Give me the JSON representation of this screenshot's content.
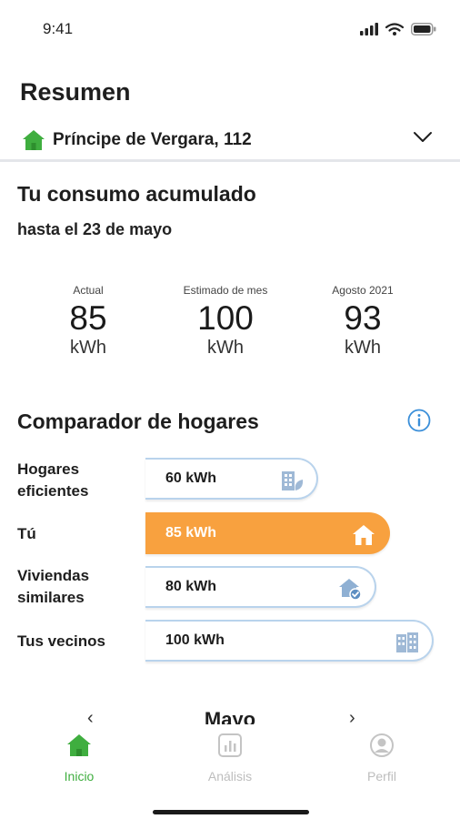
{
  "status_bar": {
    "time": "9:41"
  },
  "header": {
    "title": "Resumen"
  },
  "address": {
    "text": "Príncipe de Vergara, 112"
  },
  "consumption": {
    "title": "Tu consumo acumulado",
    "subtitle": "hasta el 23 de mayo",
    "stats": [
      {
        "label": "Actual",
        "value": "85",
        "unit": "kWh"
      },
      {
        "label": "Estimado de mes",
        "value": "100",
        "unit": "kWh"
      },
      {
        "label": "Agosto 2021",
        "value": "93",
        "unit": "kWh"
      }
    ]
  },
  "comparator": {
    "title": "Comparador de hogares",
    "rows": [
      {
        "label_line1": "Hogares",
        "label_line2": "eficientes",
        "value": "60 kWh",
        "kwh": 60,
        "icon": "efficient-building-icon"
      },
      {
        "label_line1": "Tú",
        "label_line2": "",
        "value": "85 kWh",
        "kwh": 85,
        "icon": "home-icon"
      },
      {
        "label_line1": "Viviendas",
        "label_line2": "similares",
        "value": "80 kWh",
        "kwh": 80,
        "icon": "home-check-icon"
      },
      {
        "label_line1": "Tus vecinos",
        "label_line2": "",
        "value": "100 kWh",
        "kwh": 100,
        "icon": "building-icon"
      }
    ]
  },
  "month_nav": {
    "label": "Mayo",
    "prev": "‹",
    "next": "›"
  },
  "tabs": [
    {
      "label": "Inicio",
      "icon": "home-icon",
      "active": true
    },
    {
      "label": "Análisis",
      "icon": "chart-icon",
      "active": false
    },
    {
      "label": "Perfil",
      "icon": "user-icon",
      "active": false
    }
  ],
  "colors": {
    "accent_green": "#3fae3f",
    "highlight_orange": "#f8a13f",
    "bar_border": "#b9d3ec",
    "info_blue": "#3b8fd9"
  }
}
